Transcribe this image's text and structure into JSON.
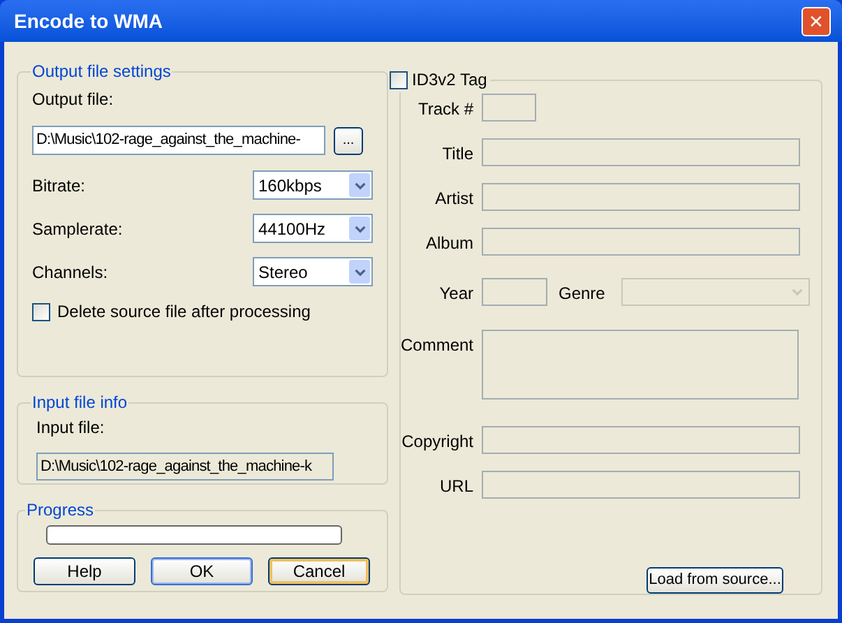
{
  "window": {
    "title": "Encode to WMA",
    "close": "✕"
  },
  "output_settings": {
    "legend": "Output file settings",
    "output_file_label": "Output file:",
    "output_file": "D:\\Music\\102-rage_against_the_machine-",
    "browse": "...",
    "selects": [
      {
        "label": "Bitrate:",
        "value": "160kbps"
      },
      {
        "label": "Samplerate:",
        "value": "44100Hz"
      },
      {
        "label": "Channels:",
        "value": "Stereo"
      }
    ],
    "delete_source": {
      "label": "Delete source file after processing",
      "checked": false
    }
  },
  "input_info": {
    "legend": "Input file info",
    "label": "Input file:",
    "value": "D:\\Music\\102-rage_against_the_machine-k"
  },
  "progress": {
    "legend": "Progress",
    "level": 0
  },
  "buttons": [
    {
      "label": "Help"
    },
    {
      "label": "OK"
    },
    {
      "label": "Cancel"
    }
  ],
  "id3": {
    "label": "ID3v2 Tag",
    "checked": false,
    "fields": [
      {
        "label": "Track #",
        "kind": "short"
      },
      {
        "label": "Title",
        "kind": "text"
      },
      {
        "label": "Artist",
        "kind": "text"
      },
      {
        "label": "Album",
        "kind": "text"
      },
      {
        "label": "Year",
        "kind": "year"
      },
      {
        "label": "Comment",
        "kind": "memo"
      },
      {
        "label": "Copyright",
        "kind": "text"
      },
      {
        "label": "URL",
        "kind": "text"
      }
    ],
    "genre_label": "Genre",
    "load_button": "Load from source..."
  }
}
